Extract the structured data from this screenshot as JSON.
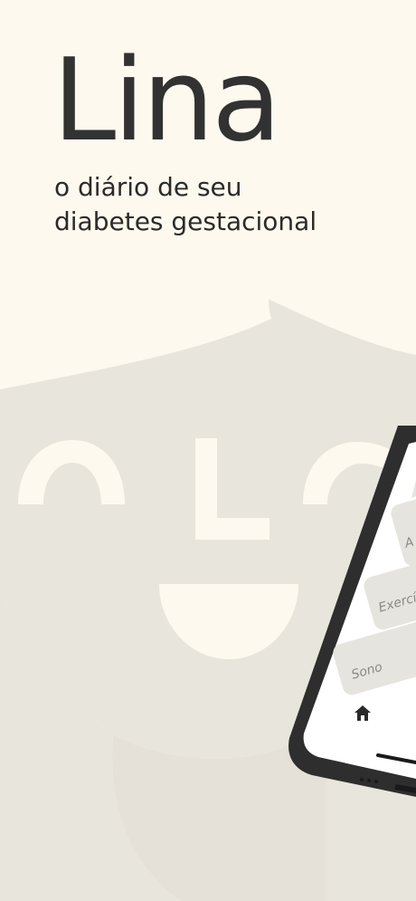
{
  "app": {
    "title": "Lina",
    "tagline_line1": "o diário de seu",
    "tagline_line2": "diabetes gestacional"
  },
  "phone_screen": {
    "items": [
      {
        "label": "A"
      },
      {
        "label": "Exercíc"
      },
      {
        "label": "Sono"
      }
    ],
    "tabbar_icon": "home-icon"
  },
  "colors": {
    "background": "#fdf9ee",
    "face": "#e8e5dc",
    "title": "#333232",
    "text": "#2b2b2b",
    "phone_frame": "#2e2e2e",
    "screen_card": "#e6e4de"
  }
}
